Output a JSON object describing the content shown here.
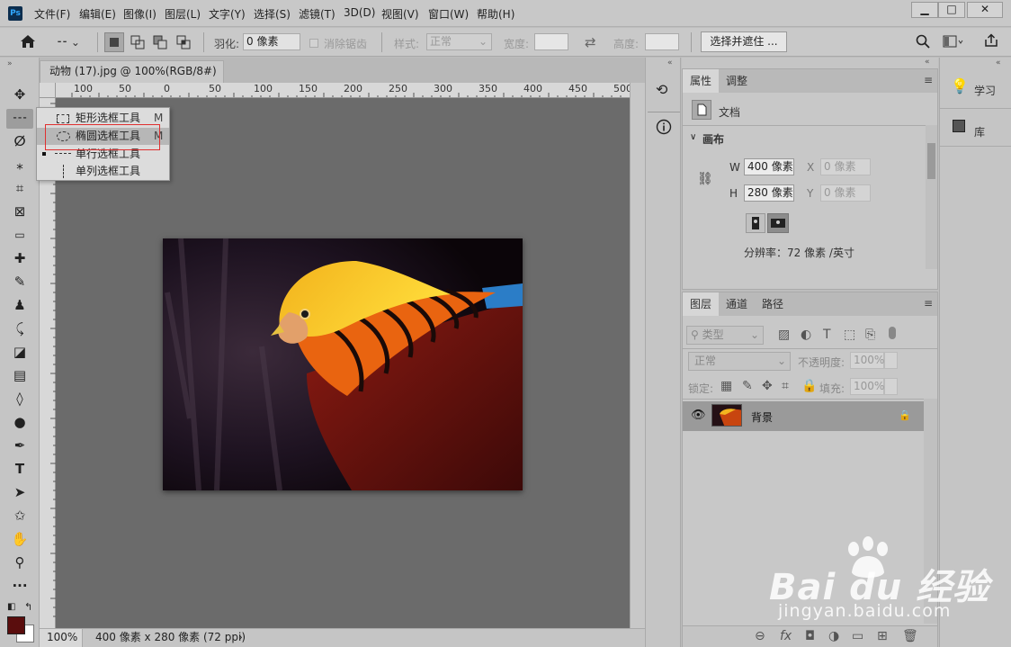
{
  "app": {
    "logo": "Ps"
  },
  "menu": [
    "文件(F)",
    "编辑(E)",
    "图像(I)",
    "图层(L)",
    "文字(Y)",
    "选择(S)",
    "滤镜(T)",
    "3D(D)",
    "视图(V)",
    "窗口(W)",
    "帮助(H)"
  ],
  "window_controls": {
    "minimize": "▁",
    "maximize": "□",
    "close": "✕"
  },
  "options": {
    "feather_label": "羽化:",
    "feather_value": "0 像素",
    "antialias_label": "消除锯齿",
    "style_label": "样式:",
    "style_value": "正常",
    "width_label": "宽度:",
    "height_label": "高度:",
    "select_mask_button": "选择并遮住 ..."
  },
  "document": {
    "tab_title": "动物 (17).jpg @ 100%(RGB/8#) *",
    "tab_close": "×"
  },
  "ruler_h": [
    "100",
    "50",
    "0",
    "50",
    "100",
    "150",
    "200",
    "250",
    "300",
    "350",
    "400",
    "450",
    "500"
  ],
  "flyout": {
    "items": [
      {
        "label": "矩形选框工具",
        "key": "M"
      },
      {
        "label": "椭圆选框工具",
        "key": "M"
      },
      {
        "label": "单行选框工具",
        "key": ""
      },
      {
        "label": "单列选框工具",
        "key": ""
      }
    ]
  },
  "status": {
    "zoom": "100%",
    "info": "400 像素 x 280 像素 (72 ppi)",
    "arrow": "›"
  },
  "properties": {
    "tabs": [
      "属性",
      "调整"
    ],
    "doc_label": "文档",
    "section": "画布",
    "w_label": "W",
    "w_value": "400 像素",
    "h_label": "H",
    "h_value": "280 像素",
    "x_label": "X",
    "x_value": "0 像素",
    "y_label": "Y",
    "y_value": "0 像素",
    "resolution": "分辨率：72 像素 /英寸"
  },
  "layers": {
    "tabs": [
      "图层",
      "通道",
      "路径"
    ],
    "filter_placeholder": "类型",
    "blend_mode": "正常",
    "opacity_label": "不透明度:",
    "opacity_value": "100%",
    "lock_label": "锁定:",
    "fill_label": "填充:",
    "fill_value": "100%",
    "layer_name": "背景"
  },
  "dock2": {
    "learn": "学习",
    "library": "库"
  },
  "watermark": {
    "brand": "Bai du 经验",
    "url": "jingyan.baidu.com"
  },
  "colors": {
    "foreground": "#5a0d0d",
    "background": "#ffffff",
    "highlight_box": "#e03030"
  }
}
